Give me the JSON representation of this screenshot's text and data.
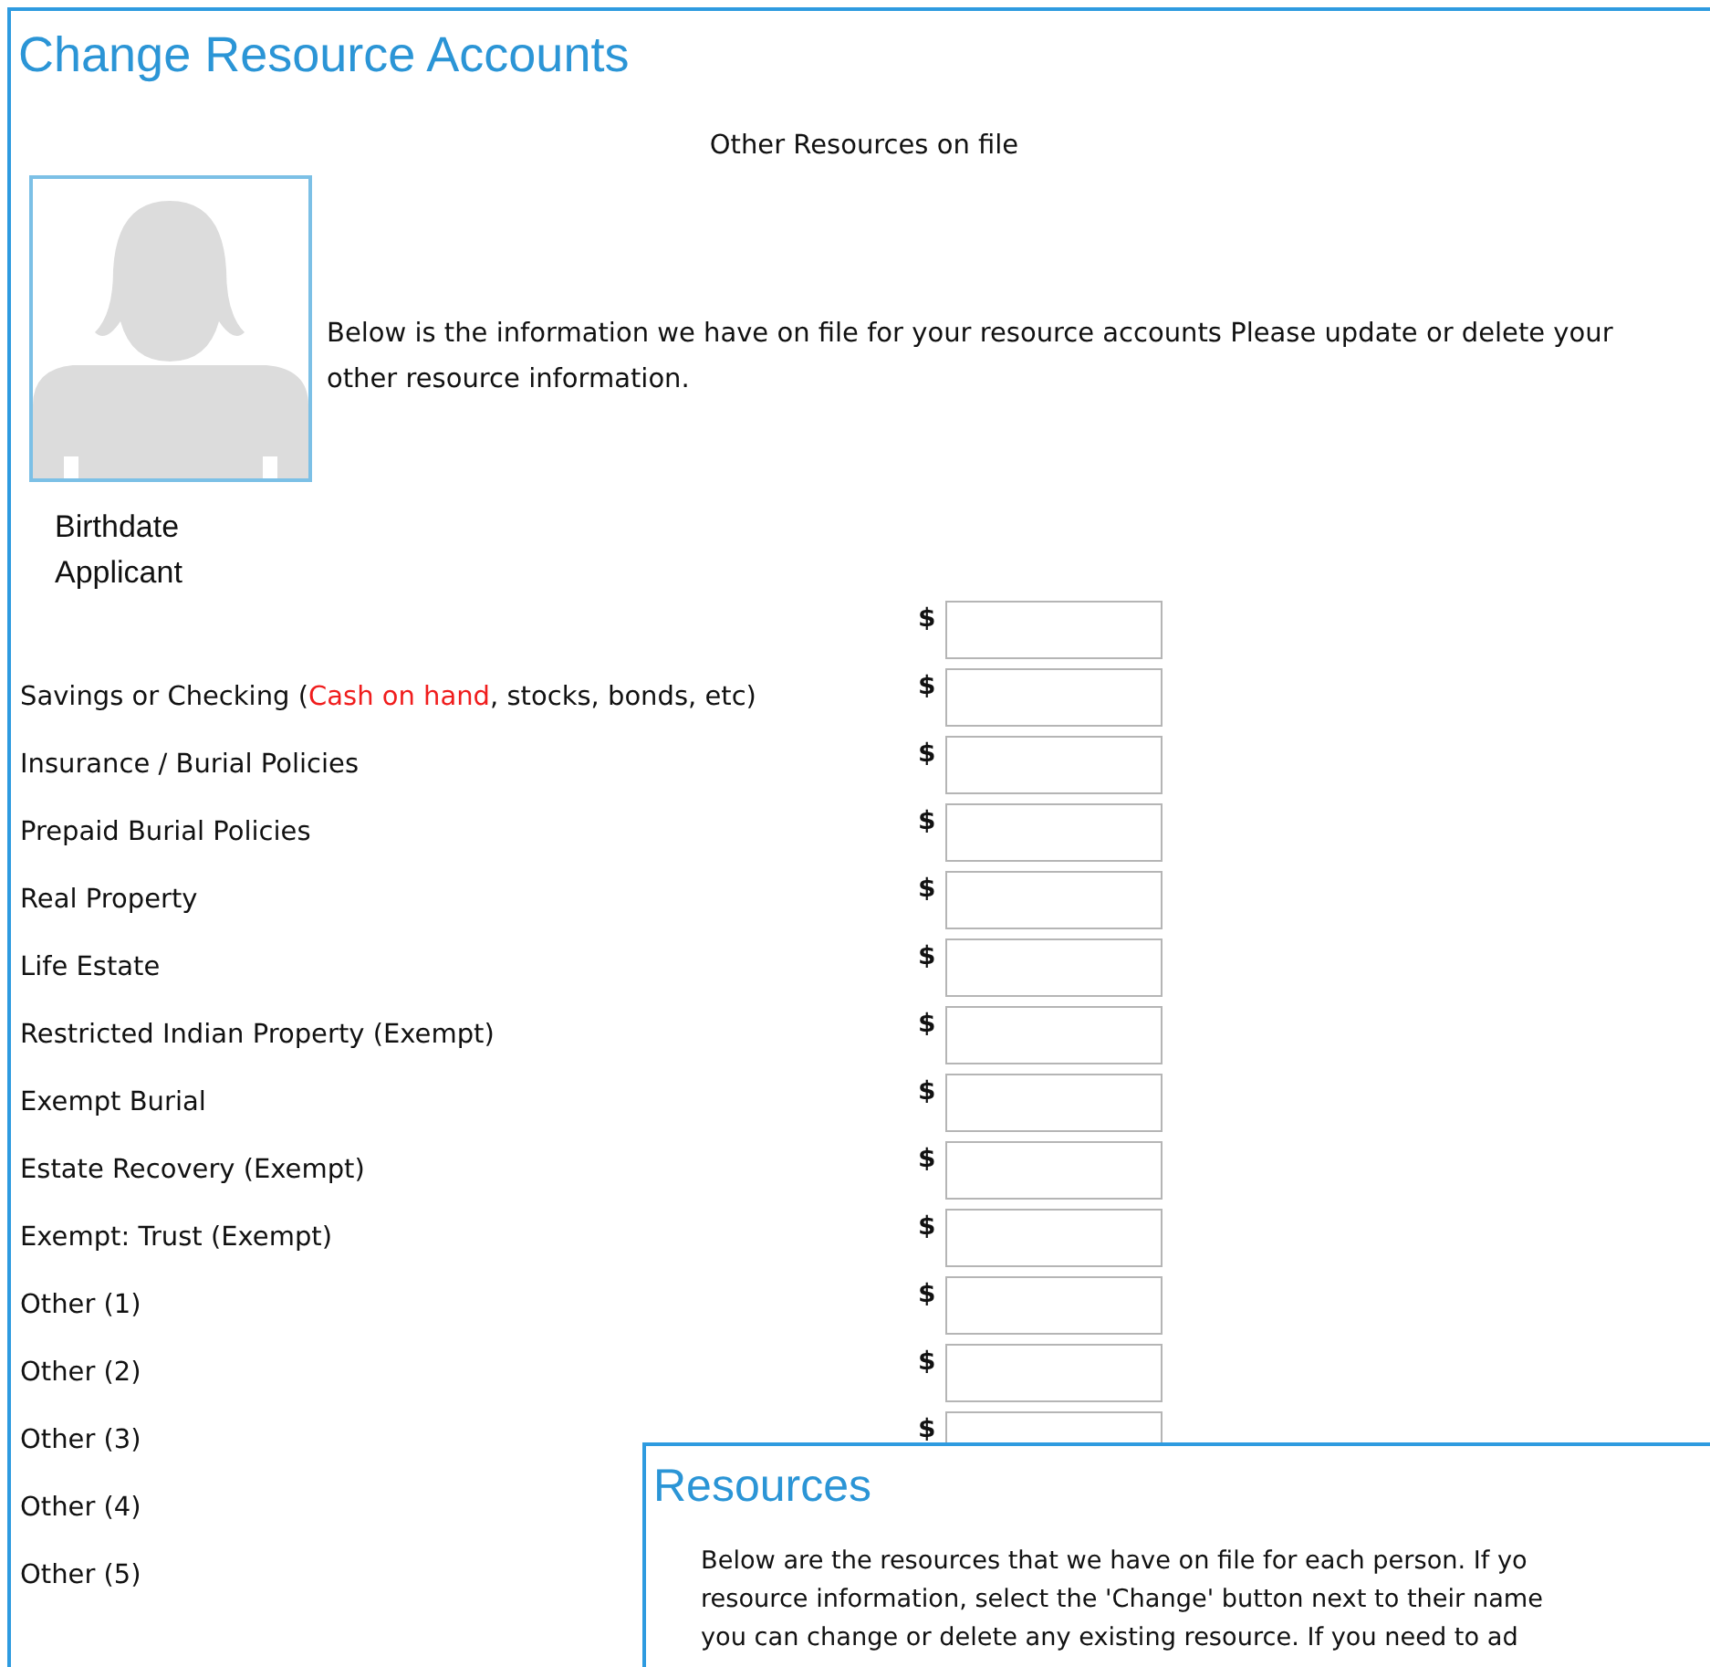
{
  "page": {
    "title": "Change Resource Accounts",
    "subtitle": "Other Resources on file"
  },
  "applicant": {
    "lines": [
      "Birthdate",
      "Applicant"
    ]
  },
  "intro": "Below is the information we have on file for your resource accounts Please update or delete your other resource information.",
  "currency_symbol": "$",
  "rows": [
    {
      "label": []
    },
    {
      "label": [
        {
          "text": "Savings or Checking ("
        },
        {
          "text": "Cash on hand",
          "highlight": true
        },
        {
          "text": ", stocks, bonds, etc)"
        }
      ]
    },
    {
      "label": [
        {
          "text": "Insurance / Burial Policies"
        }
      ]
    },
    {
      "label": [
        {
          "text": "Prepaid Burial Policies"
        }
      ]
    },
    {
      "label": [
        {
          "text": "Real Property"
        }
      ]
    },
    {
      "label": [
        {
          "text": "Life Estate"
        }
      ]
    },
    {
      "label": [
        {
          "text": "Restricted Indian Property (Exempt)"
        }
      ]
    },
    {
      "label": [
        {
          "text": "Exempt Burial"
        }
      ]
    },
    {
      "label": [
        {
          "text": "Estate Recovery (Exempt)"
        }
      ]
    },
    {
      "label": [
        {
          "text": "Exempt: Trust (Exempt)"
        }
      ]
    },
    {
      "label": [
        {
          "text": "Other (1)"
        }
      ]
    },
    {
      "label": [
        {
          "text": "Other (2)"
        }
      ]
    },
    {
      "label": [
        {
          "text": "Other (3)"
        }
      ]
    },
    {
      "label": [
        {
          "text": "Other (4)"
        }
      ],
      "hidden_field": true
    },
    {
      "label": [
        {
          "text": "Other (5)"
        }
      ],
      "hidden_field": true
    }
  ],
  "overlay": {
    "title": "Resources",
    "lines": [
      "Below are the resources that we have on file for each person. If yo",
      "resource information, select the 'Change' button next to their name",
      "you can change or delete any existing resource. If you need to ad"
    ]
  }
}
